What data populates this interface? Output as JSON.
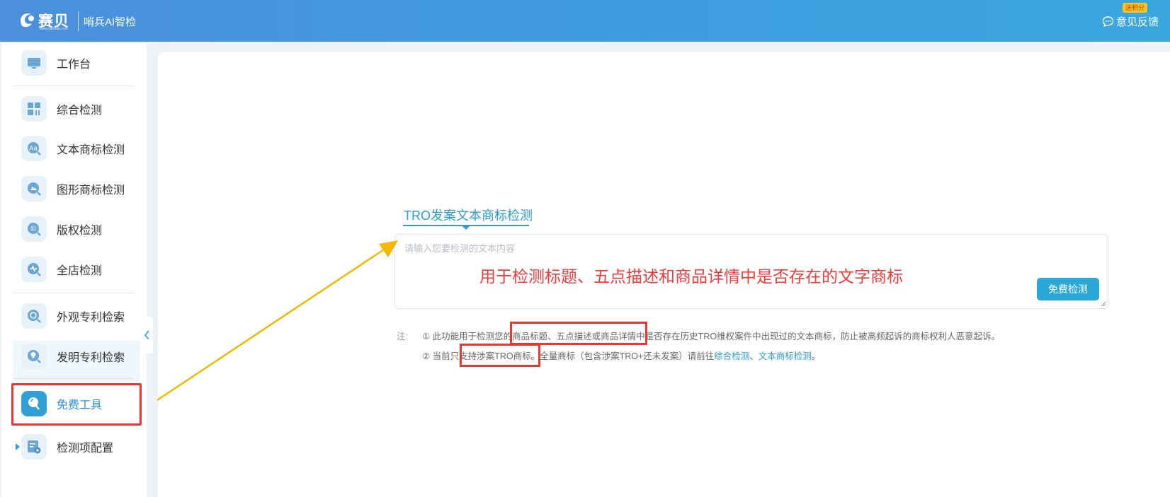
{
  "header": {
    "logo_text": "赛贝",
    "logo_url": "www.saibeiip.com",
    "product_name": "哨兵AI智检",
    "feedback_label": "意见反馈",
    "feedback_badge": "送积分"
  },
  "sidebar": {
    "items": [
      {
        "label": "工作台",
        "icon": "monitor-icon"
      },
      {
        "label": "综合检测",
        "icon": "grid-icon"
      },
      {
        "label": "文本商标检测",
        "icon": "text-search-icon"
      },
      {
        "label": "图形商标检测",
        "icon": "image-search-icon"
      },
      {
        "label": "版权检测",
        "icon": "copyright-search-icon"
      },
      {
        "label": "全店检测",
        "icon": "store-search-icon"
      },
      {
        "label": "外观专利检索",
        "icon": "patent-design-icon"
      },
      {
        "label": "发明专利检索",
        "icon": "patent-invention-icon"
      },
      {
        "label": "免费工具",
        "icon": "free-tool-icon",
        "active": true
      },
      {
        "label": "检测项配置",
        "icon": "config-icon"
      }
    ]
  },
  "main": {
    "tab_title": "TRO发案文本商标检测",
    "input_placeholder": "请输入您要检测的文本内容",
    "annotation": "用于检测标题、五点描述和商品详情中是否存在的文字商标",
    "check_button": "免费检测",
    "notes": {
      "label": "注:",
      "line1": "① 此功能用于检测您的商品标题、五点描述或商品详情中是否存在历史TRO维权案件中出现过的文本商标，防止被高频起诉的商标权利人恶意起诉。",
      "line2_prefix": "② 当前只支持涉案TRO商标。全量商标（包含涉案TRO+还未发案）请前往",
      "link1": "综合检测",
      "separator": "、",
      "link2": "文本商标检测",
      "line2_suffix": "。"
    }
  },
  "colors": {
    "header_start": "#4c8fdc",
    "header_end": "#3aa6de",
    "accent": "#2a9dd4",
    "annotation_red": "#e53935",
    "arrow_yellow": "#f5b800"
  }
}
